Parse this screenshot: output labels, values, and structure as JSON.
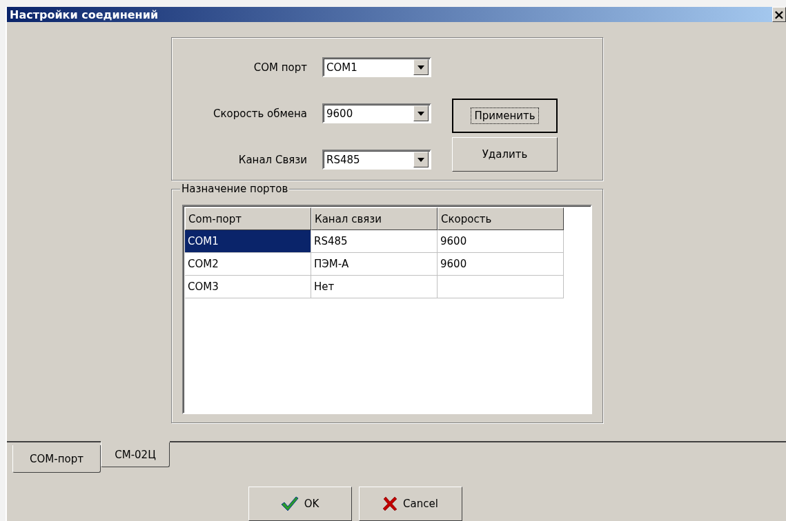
{
  "window": {
    "title": "Настройки соединений",
    "close": "×"
  },
  "settings": {
    "fields": [
      {
        "label": "COM порт",
        "value": "COM1"
      },
      {
        "label": "Скорость обмена",
        "value": "9600"
      },
      {
        "label": "Канал Связи",
        "value": "RS485"
      }
    ],
    "buttons": [
      {
        "label": "Применить",
        "focused": true
      },
      {
        "label": "Удалить",
        "focused": false
      }
    ]
  },
  "ports": {
    "title": "Назначение портов",
    "columns": [
      "Com-порт",
      "Канал связи",
      "Скорость"
    ],
    "rows": [
      {
        "cells": [
          "COM1",
          "RS485",
          "9600"
        ],
        "selected": true
      },
      {
        "cells": [
          "COM2",
          "ПЭМ-А",
          "9600"
        ],
        "selected": false
      },
      {
        "cells": [
          "COM3",
          "Нет",
          ""
        ],
        "selected": false
      }
    ]
  },
  "tabs": [
    {
      "label": "COM-порт",
      "selected": true
    },
    {
      "label": "CM-02Ц",
      "selected": false
    }
  ],
  "buttons": [
    {
      "label": "OK",
      "kind": "ok"
    },
    {
      "label": "Cancel",
      "kind": "cancel"
    }
  ]
}
